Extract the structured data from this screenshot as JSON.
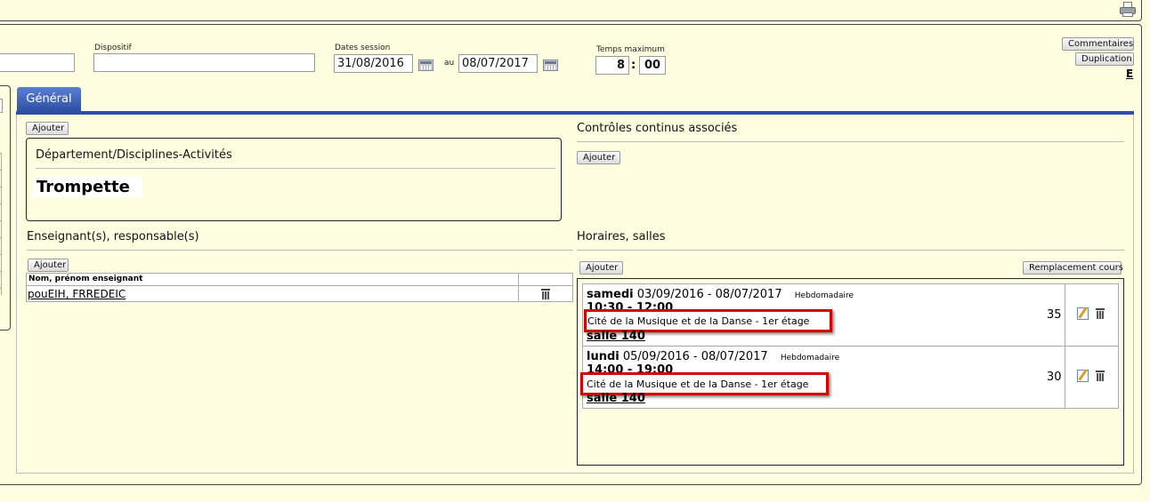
{
  "header": {
    "print_icon": "printer-icon"
  },
  "session": {
    "dispositif_label": "Dispositif",
    "dispositif_value": "",
    "dates_label": "Dates session",
    "date_start": "31/08/2016",
    "au_label": "au",
    "date_end": "08/07/2017",
    "temps_label": "Temps maximum",
    "hours": "8",
    "colon": ":",
    "minutes": "00",
    "commentaires_label": "Commentaires",
    "duplication_label": "Duplication",
    "e_link": "E"
  },
  "tabs": [
    {
      "label": "Général"
    }
  ],
  "left": {
    "ajouter_label": "Ajouter",
    "dept_title": "Département/Disciplines-Activités",
    "discipline": "Trompette",
    "enseignants_title": "Enseignant(s), responsable(s)",
    "ajouter2_label": "Ajouter",
    "table_header": "Nom, prénom enseignant",
    "teacher_name": "pouEIH, FRREDEIC"
  },
  "right": {
    "controles_title": "Contrôles continus associés",
    "ajouter_label": "Ajouter",
    "horaires_title": "Horaires, salles",
    "ajouter2_label": "Ajouter",
    "remplacement_label": "Remplacement cours",
    "schedules": [
      {
        "day": "samedi",
        "dates": "03/09/2016 - 08/07/2017",
        "freq": "Hebdomadaire",
        "time": "10:30 - 12:00",
        "location": "Cité de la Musique et de la Danse - 1er étage",
        "room": "salle 140",
        "count": "35"
      },
      {
        "day": "lundi",
        "dates": "05/09/2016 - 08/07/2017",
        "freq": "Hebdomadaire",
        "time": "14:00 - 19:00",
        "location": "Cité de la Musique et de la Danse - 1er étage",
        "room": "salle 140",
        "count": "30"
      }
    ]
  }
}
